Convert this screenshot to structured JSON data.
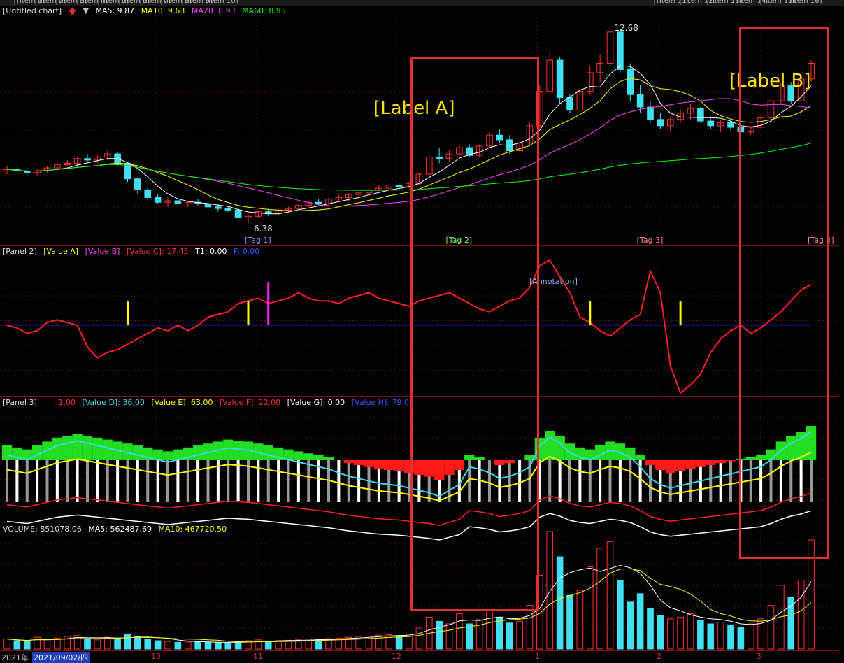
{
  "window": {
    "title": "[Untitled chart]",
    "indicators_toggle": "▼",
    "toolbar": [
      "[Item 1]",
      "[Item 2]",
      "[Item 3]",
      "[Item 4]",
      "[Item 5]",
      "[Item 6]",
      "[Item 7]",
      "[Item 8]",
      "[Item 9]",
      "[Item 10]"
    ],
    "toolbar_right": [
      "[Item 11]",
      "[Item 12]",
      "[Item 13]",
      "[Item 14]",
      "[Item 15]",
      "[Item 16]"
    ]
  },
  "main_panel": {
    "ma5": "MA5: 9.87",
    "ma10": "MA10: 9.63",
    "ma20": "MA20: 8.93",
    "ma60": "MA60: 8.95",
    "colors": {
      "ma5": "#ffffff",
      "ma10": "#ffff00",
      "ma20": "#ff40ff",
      "ma60": "#00ff00",
      "up": "#ff3030",
      "down": "#40e0f0"
    },
    "high_label": "12.68",
    "low_label": "6.38",
    "markers": [
      {
        "text": "[Tag 1]",
        "color": "#66a3ff"
      },
      {
        "text": "[Tag 2]",
        "color": "#66ff66"
      },
      {
        "text": "[Tag 3]",
        "color": "#ff8080"
      },
      {
        "text": "[Tag 4]",
        "color": "#ff8080"
      }
    ]
  },
  "panel2": {
    "name": "[Panel 2]",
    "f1": "[Value A]",
    "f2": "[Value B]",
    "f3": "[Value C]: 17.45",
    "f4": "T1: 0.00",
    "f5": "F: 0.00",
    "note": "[Annotation]"
  },
  "panel3": {
    "name": "[Panel 3]",
    "f1": ": 1.00",
    "f2": "[Value D]: 36.00",
    "f3": "[Value E]: 63.00",
    "f4": "[Value F]: 22.00",
    "f5": "[Value G]: 0.00",
    "f6": "[Value H]: 79.00"
  },
  "volume_panel": {
    "vol": "VOLUME: 851078.06",
    "ma5": "MA5: 562487.69",
    "ma10": "MA10: 467720.50"
  },
  "annotations": {
    "left": "[Label A]",
    "right": "[Label B]"
  },
  "x_axis": {
    "labels": [
      "2021年",
      "2021/09/02/四",
      "10",
      "11",
      "12",
      "1",
      "2",
      "3"
    ]
  },
  "chart_data": {
    "type": "candlestick",
    "period": "daily",
    "ohlc": [
      [
        8.05,
        8.2,
        7.95,
        8.1
      ],
      [
        8.1,
        8.25,
        8.0,
        8.05
      ],
      [
        8.05,
        8.15,
        7.9,
        8.0
      ],
      [
        8.0,
        8.1,
        7.9,
        8.05
      ],
      [
        8.05,
        8.2,
        8.0,
        8.15
      ],
      [
        8.15,
        8.3,
        8.1,
        8.25
      ],
      [
        8.25,
        8.4,
        8.2,
        8.3
      ],
      [
        8.3,
        8.5,
        8.2,
        8.45
      ],
      [
        8.45,
        8.6,
        8.35,
        8.4
      ],
      [
        8.4,
        8.55,
        8.3,
        8.5
      ],
      [
        8.5,
        8.7,
        8.4,
        8.6
      ],
      [
        8.6,
        8.65,
        8.2,
        8.3
      ],
      [
        8.3,
        8.35,
        7.7,
        7.8
      ],
      [
        7.8,
        7.85,
        7.3,
        7.45
      ],
      [
        7.45,
        7.55,
        7.1,
        7.2
      ],
      [
        7.2,
        7.3,
        7.0,
        7.05
      ],
      [
        7.05,
        7.2,
        6.9,
        7.1
      ],
      [
        7.1,
        7.2,
        6.95,
        7.0
      ],
      [
        7.0,
        7.1,
        6.9,
        7.05
      ],
      [
        7.05,
        7.15,
        6.95,
        7.0
      ],
      [
        7.0,
        7.05,
        6.85,
        6.9
      ],
      [
        6.9,
        7.0,
        6.75,
        6.85
      ],
      [
        6.85,
        6.95,
        6.75,
        6.8
      ],
      [
        6.8,
        6.85,
        6.45,
        6.55
      ],
      [
        6.55,
        6.65,
        6.38,
        6.6
      ],
      [
        6.6,
        6.8,
        6.55,
        6.75
      ],
      [
        6.75,
        6.85,
        6.6,
        6.7
      ],
      [
        6.7,
        6.85,
        6.65,
        6.8
      ],
      [
        6.8,
        6.9,
        6.7,
        6.85
      ],
      [
        6.85,
        7.0,
        6.8,
        6.95
      ],
      [
        6.95,
        7.1,
        6.9,
        7.05
      ],
      [
        7.05,
        7.15,
        6.95,
        7.0
      ],
      [
        7.0,
        7.2,
        6.95,
        7.15
      ],
      [
        7.15,
        7.3,
        7.1,
        7.2
      ],
      [
        7.2,
        7.35,
        7.1,
        7.3
      ],
      [
        7.3,
        7.4,
        7.2,
        7.35
      ],
      [
        7.35,
        7.5,
        7.3,
        7.45
      ],
      [
        7.45,
        7.6,
        7.4,
        7.5
      ],
      [
        7.5,
        7.65,
        7.45,
        7.6
      ],
      [
        7.6,
        7.7,
        7.5,
        7.55
      ],
      [
        7.55,
        7.7,
        7.5,
        7.65
      ],
      [
        7.65,
        8.0,
        7.6,
        7.95
      ],
      [
        7.95,
        8.6,
        7.9,
        8.5
      ],
      [
        8.5,
        8.8,
        8.3,
        8.45
      ],
      [
        8.45,
        8.7,
        8.35,
        8.6
      ],
      [
        8.6,
        8.9,
        8.5,
        8.8
      ],
      [
        8.8,
        8.9,
        8.5,
        8.55
      ],
      [
        8.55,
        8.9,
        8.5,
        8.85
      ],
      [
        8.85,
        9.3,
        8.8,
        9.2
      ],
      [
        9.2,
        9.4,
        8.95,
        9.05
      ],
      [
        9.05,
        9.2,
        8.6,
        8.7
      ],
      [
        8.7,
        9.0,
        8.65,
        8.95
      ],
      [
        8.95,
        9.6,
        8.9,
        9.5
      ],
      [
        9.5,
        10.8,
        9.4,
        10.6
      ],
      [
        10.6,
        11.9,
        10.5,
        11.6
      ],
      [
        11.6,
        11.7,
        10.2,
        10.4
      ],
      [
        10.4,
        10.5,
        9.9,
        10.0
      ],
      [
        10.0,
        10.7,
        9.95,
        10.6
      ],
      [
        10.6,
        11.4,
        10.5,
        11.2
      ],
      [
        11.2,
        11.8,
        10.9,
        11.5
      ],
      [
        11.5,
        12.68,
        11.4,
        12.5
      ],
      [
        12.5,
        12.6,
        11.2,
        11.3
      ],
      [
        11.3,
        11.5,
        10.3,
        10.5
      ],
      [
        10.5,
        10.8,
        9.9,
        10.1
      ],
      [
        10.1,
        10.3,
        9.6,
        9.7
      ],
      [
        9.7,
        9.9,
        9.4,
        9.5
      ],
      [
        9.5,
        9.8,
        9.3,
        9.7
      ],
      [
        9.7,
        10.0,
        9.6,
        9.9
      ],
      [
        9.9,
        10.2,
        9.7,
        10.05
      ],
      [
        10.05,
        10.1,
        9.6,
        9.65
      ],
      [
        9.65,
        9.8,
        9.4,
        9.5
      ],
      [
        9.5,
        9.7,
        9.3,
        9.6
      ],
      [
        9.6,
        9.65,
        9.35,
        9.45
      ],
      [
        9.45,
        9.55,
        9.25,
        9.3
      ],
      [
        9.3,
        9.5,
        9.2,
        9.45
      ],
      [
        9.45,
        9.8,
        9.4,
        9.75
      ],
      [
        9.75,
        10.4,
        9.7,
        10.3
      ],
      [
        10.3,
        10.9,
        10.2,
        10.8
      ],
      [
        10.8,
        10.9,
        10.2,
        10.3
      ],
      [
        10.3,
        11.1,
        10.25,
        11.0
      ],
      [
        11.0,
        11.6,
        10.9,
        11.5
      ]
    ],
    "ma5": 9.87,
    "ma10": 9.63,
    "ma20": 8.93,
    "ma60": 8.95,
    "price_high": 12.68,
    "price_low": 6.38,
    "volume": [
      120,
      100,
      90,
      140,
      110,
      130,
      150,
      160,
      120,
      110,
      140,
      130,
      180,
      150,
      120,
      100,
      90,
      80,
      85,
      90,
      80,
      75,
      70,
      90,
      100,
      110,
      95,
      100,
      105,
      110,
      120,
      115,
      125,
      130,
      140,
      150,
      155,
      165,
      170,
      160,
      180,
      250,
      380,
      330,
      300,
      420,
      300,
      350,
      460,
      380,
      310,
      330,
      520,
      880,
      1400,
      1100,
      640,
      700,
      980,
      1200,
      1280,
      820,
      560,
      660,
      480,
      400,
      360,
      380,
      420,
      340,
      300,
      320,
      280,
      260,
      300,
      360,
      520,
      760,
      620,
      820,
      1300
    ],
    "volume_ma5": 562487.69,
    "volume_ma10": 467720.5,
    "panel2_series": [
      0,
      -1,
      -3,
      -2,
      1,
      2,
      1,
      0,
      -8,
      -12,
      -10,
      -9,
      -7,
      -5,
      -3,
      -1,
      -2,
      0,
      -2,
      0,
      3,
      4,
      5,
      8,
      9,
      10,
      8,
      9,
      10,
      12,
      10,
      9,
      9,
      8,
      10,
      11,
      12,
      10,
      9,
      8,
      7,
      9,
      10,
      11,
      12,
      10,
      8,
      6,
      5,
      7,
      9,
      10,
      14,
      22,
      24,
      18,
      12,
      3,
      1,
      -2,
      -4,
      -1,
      2,
      4,
      20,
      12,
      -15,
      -25,
      -22,
      -18,
      -10,
      -5,
      -2,
      0,
      -3,
      -1,
      2,
      5,
      9,
      13,
      15
    ],
    "panel3_series": [
      70,
      68,
      66,
      70,
      74,
      78,
      80,
      82,
      80,
      78,
      76,
      74,
      72,
      70,
      68,
      66,
      64,
      66,
      68,
      70,
      72,
      74,
      76,
      75,
      74,
      72,
      70,
      68,
      66,
      64,
      62,
      60,
      58,
      55,
      52,
      50,
      48,
      46,
      45,
      44,
      42,
      40,
      38,
      35,
      40,
      45,
      60,
      58,
      55,
      50,
      52,
      55,
      60,
      78,
      85,
      80,
      72,
      68,
      66,
      70,
      74,
      72,
      68,
      60,
      50,
      45,
      42,
      44,
      46,
      48,
      50,
      52,
      54,
      56,
      58,
      60,
      66,
      74,
      80,
      84,
      90
    ]
  }
}
